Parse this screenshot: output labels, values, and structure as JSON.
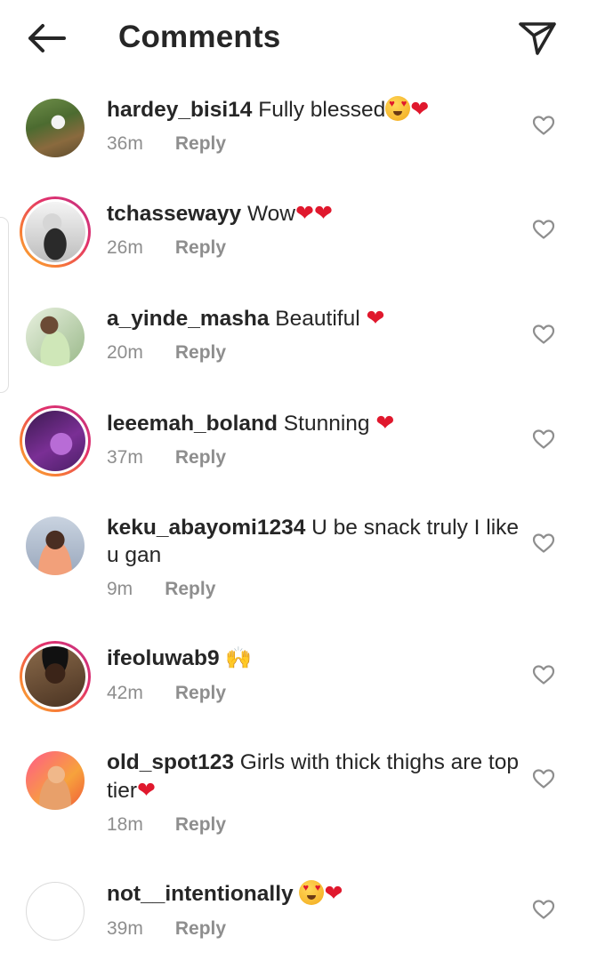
{
  "header": {
    "title": "Comments"
  },
  "comments": [
    {
      "username": "hardey_bisi14",
      "text": " Fully blessed",
      "emoji": "face-heart-eyes-emoji heart-emoji",
      "time": "36m",
      "reply_label": "Reply",
      "story_ring": false
    },
    {
      "username": "tchassewayy",
      "text": " Wow",
      "emoji": "heart-emoji heart-emoji",
      "time": "26m",
      "reply_label": "Reply",
      "story_ring": true
    },
    {
      "username": "a_yinde_masha",
      "text": " Beautiful ",
      "emoji": "heart-emoji",
      "time": "20m",
      "reply_label": "Reply",
      "story_ring": false
    },
    {
      "username": "leeemah_boland",
      "text": " Stunning ",
      "emoji": "heart-emoji",
      "time": "37m",
      "reply_label": "Reply",
      "story_ring": true
    },
    {
      "username": "keku_abayomi1234",
      "text": " U be snack truly I like u gan",
      "emoji": "",
      "time": "9m",
      "reply_label": "Reply",
      "story_ring": false
    },
    {
      "username": "ifeoluwab9",
      "text": " ",
      "emoji": "raising-hands-emoji",
      "time": "42m",
      "reply_label": "Reply",
      "story_ring": true
    },
    {
      "username": "old_spot123",
      "text": " Girls with thick thighs are top tier",
      "emoji": "heart-emoji",
      "time": "18m",
      "reply_label": "Reply",
      "story_ring": false
    },
    {
      "username": "not__intentionally",
      "text": " ",
      "emoji": "face-heart-eyes-emoji heart-emoji",
      "time": "39m",
      "reply_label": "Reply",
      "story_ring": false
    }
  ],
  "colors": {
    "text": "#262626",
    "muted": "#8e8e8e",
    "heart_emoji": "#e0182d",
    "story_ring_start": "#f9b233",
    "story_ring_end": "#c13584"
  },
  "icons": {
    "back": "arrow-left-icon",
    "share": "paper-plane-icon",
    "like": "heart-outline-icon"
  }
}
